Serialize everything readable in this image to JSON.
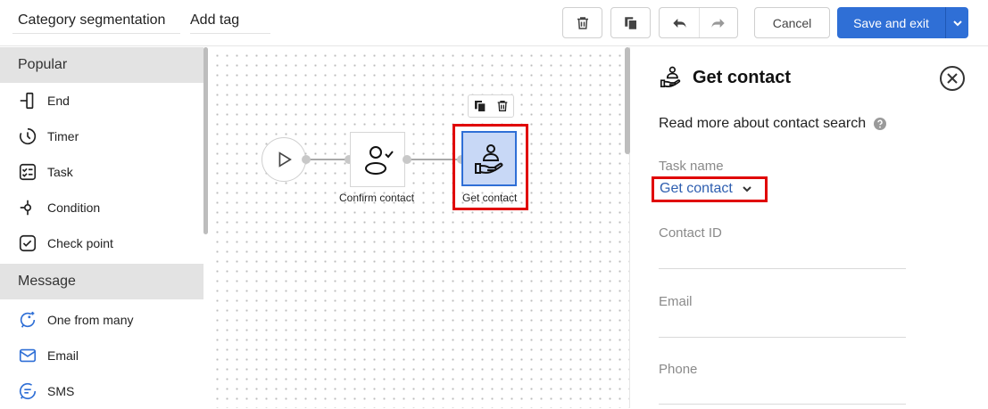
{
  "header": {
    "segment_name": "Category segmentation",
    "add_tag_label": "Add tag",
    "cancel_label": "Cancel",
    "save_label": "Save and exit"
  },
  "sidebar": {
    "sections": [
      {
        "title": "Popular",
        "items": [
          {
            "label": "End",
            "icon": "end-icon"
          },
          {
            "label": "Timer",
            "icon": "timer-icon"
          },
          {
            "label": "Task",
            "icon": "task-icon"
          },
          {
            "label": "Condition",
            "icon": "condition-icon"
          },
          {
            "label": "Check point",
            "icon": "check-point-icon"
          }
        ]
      },
      {
        "title": "Message",
        "items": [
          {
            "label": "One from many",
            "icon": "sparkle-chat-icon"
          },
          {
            "label": "Email",
            "icon": "email-icon"
          },
          {
            "label": "SMS",
            "icon": "sms-icon"
          }
        ]
      }
    ]
  },
  "canvas": {
    "nodes": [
      {
        "label": "Confirm contact",
        "icon": "confirm-contact-icon",
        "selected": false
      },
      {
        "label": "Get contact",
        "icon": "get-contact-icon",
        "selected": true
      }
    ]
  },
  "panel": {
    "title": "Get contact",
    "read_more": "Read more about contact search",
    "task_name_label": "Task name",
    "task_name_value": "Get contact",
    "fields": [
      "Contact ID",
      "Email",
      "Phone"
    ]
  },
  "colors": {
    "accent": "#2f6fd6",
    "highlight": "#e00000",
    "selected_node_bg": "#c8d8f6"
  }
}
